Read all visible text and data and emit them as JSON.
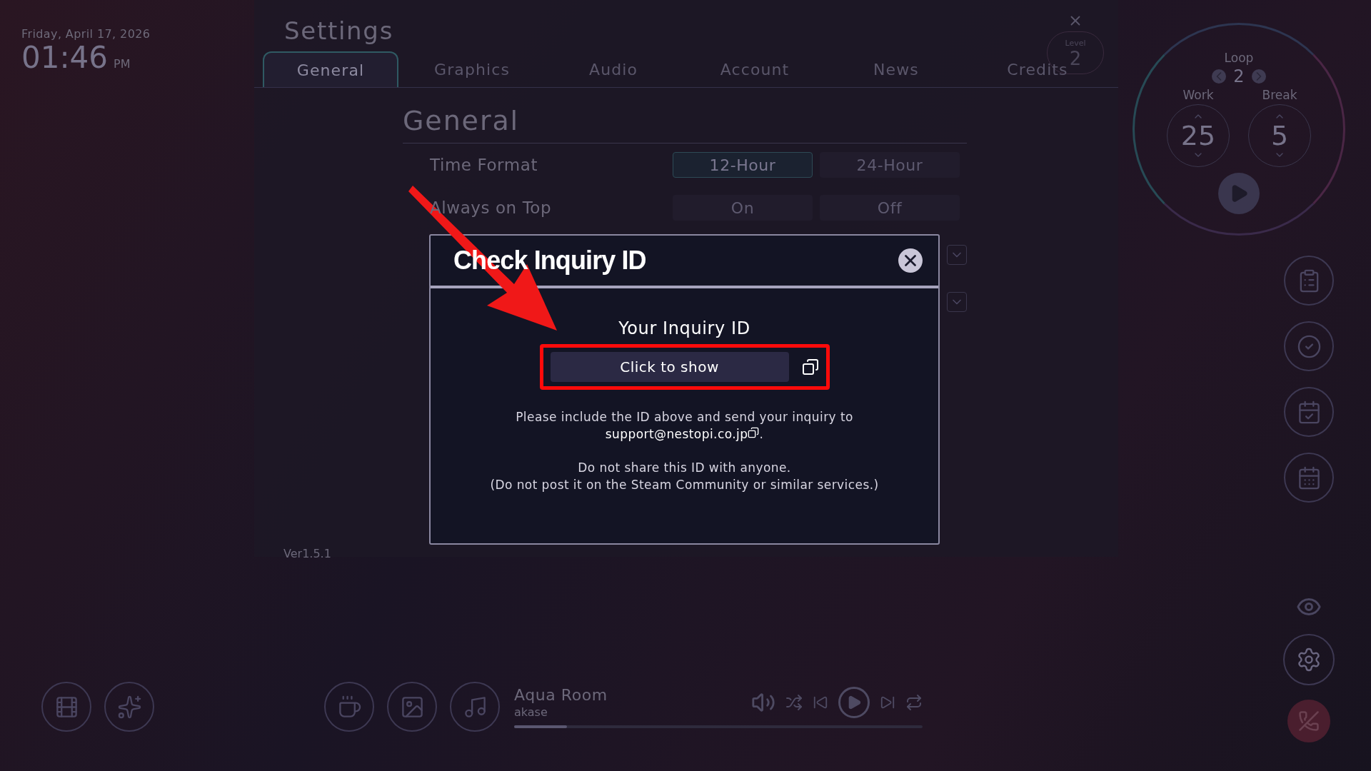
{
  "clock": {
    "date": "Friday, April 17, 2026",
    "time": "01:46",
    "meridiem": "PM"
  },
  "settings": {
    "title": "Settings",
    "level_label": "Level",
    "level_value": "2",
    "tabs": [
      {
        "label": "General",
        "selected": true
      },
      {
        "label": "Graphics",
        "selected": false
      },
      {
        "label": "Audio",
        "selected": false
      },
      {
        "label": "Account",
        "selected": false
      },
      {
        "label": "News",
        "selected": false
      },
      {
        "label": "Credits",
        "selected": false
      }
    ],
    "section_title": "General",
    "rows": [
      {
        "label": "Time Format",
        "options": [
          {
            "label": "12-Hour",
            "selected": true
          },
          {
            "label": "24-Hour",
            "selected": false
          }
        ]
      },
      {
        "label": "Always on Top",
        "options": [
          {
            "label": "On",
            "selected": false
          },
          {
            "label": "Off",
            "selected": false
          }
        ]
      }
    ],
    "version": "Ver1.5.1"
  },
  "dialog": {
    "title": "Check Inquiry ID",
    "subtitle": "Your Inquiry ID",
    "button": "Click to show",
    "instructions": "Please include the ID above and send your inquiry to",
    "email": "support@nestopi.co.jp",
    "email_end": ".",
    "warning": "Do not share this ID with anyone.",
    "warning_note": "(Do not post it on the Steam Community or similar services.)"
  },
  "timer": {
    "loop_label": "Loop",
    "loop": "2",
    "work_label": "Work",
    "work": "25",
    "break_label": "Break",
    "break": "5"
  },
  "player": {
    "title": "Aqua Room",
    "artist": "akase",
    "level": 0.13
  }
}
